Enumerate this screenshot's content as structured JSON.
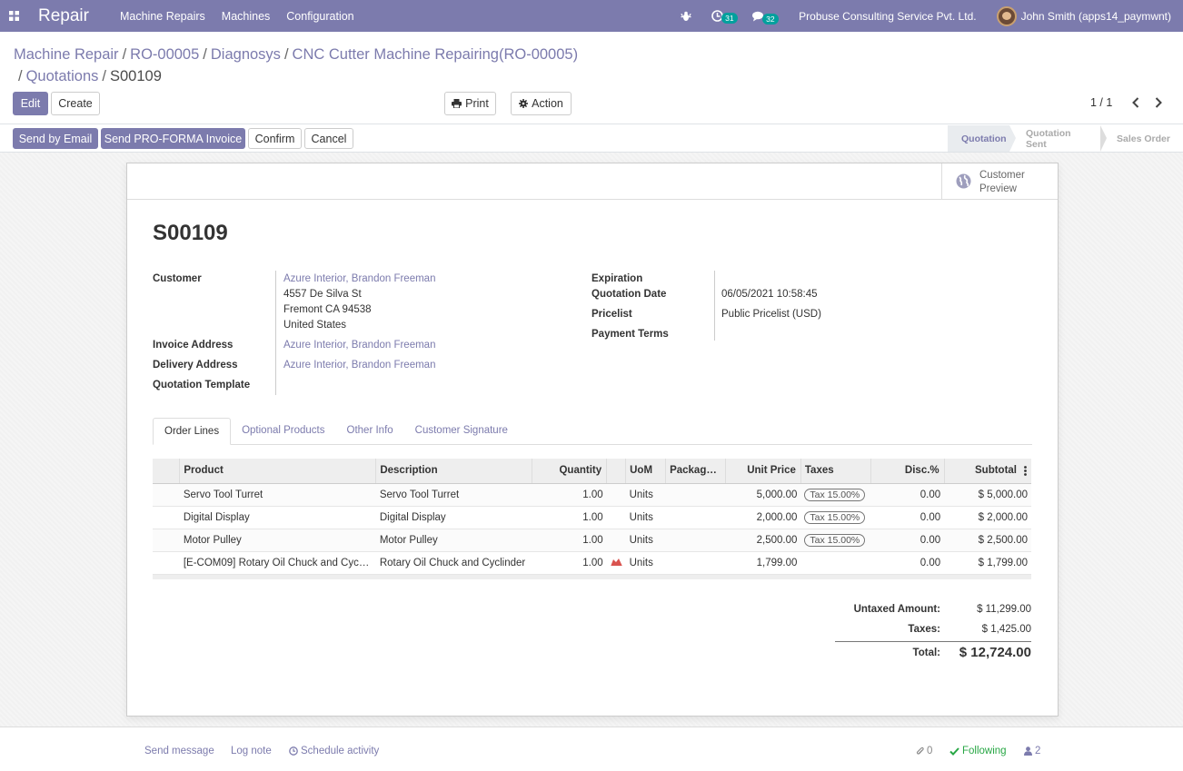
{
  "navbar": {
    "app_name": "Repair",
    "menu": [
      "Machine Repairs",
      "Machines",
      "Configuration"
    ],
    "activity_count": "31",
    "message_count": "32",
    "company": "Probuse Consulting Service Pvt. Ltd.",
    "user": "John Smith (apps14_paymwnt)",
    "brand_color": "#7c7bad"
  },
  "breadcrumb": {
    "items": [
      "Machine Repair",
      "RO-00005",
      "Diagnosys",
      "CNC Cutter Machine Repairing(RO-00005)",
      "Quotations"
    ],
    "current": "S00109",
    "separator": "/"
  },
  "controls": {
    "edit": "Edit",
    "create": "Create",
    "print": "Print",
    "action": "Action",
    "pager": "1 / 1"
  },
  "header_buttons": {
    "send_email": "Send by Email",
    "send_proforma": "Send PRO-FORMA Invoice",
    "confirm": "Confirm",
    "cancel": "Cancel"
  },
  "statusbar": [
    "Quotation",
    "Quotation Sent",
    "Sales Order"
  ],
  "preview": {
    "line1": "Customer",
    "line2": "Preview"
  },
  "form": {
    "title": "S00109",
    "customer_label": "Customer",
    "customer_name": "Azure Interior, Brandon Freeman",
    "customer_street": "4557 De Silva St",
    "customer_city": "Fremont CA 94538",
    "customer_country": "United States",
    "invoice_label": "Invoice Address",
    "invoice_value": "Azure Interior, Brandon Freeman",
    "delivery_label": "Delivery Address",
    "delivery_value": "Azure Interior, Brandon Freeman",
    "template_label": "Quotation Template",
    "expiration_label": "Expiration",
    "quote_date_label": "Quotation Date",
    "quote_date_value": "06/05/2021 10:58:45",
    "pricelist_label": "Pricelist",
    "pricelist_value": "Public Pricelist (USD)",
    "payment_terms_label": "Payment Terms"
  },
  "tabs": [
    "Order Lines",
    "Optional Products",
    "Other Info",
    "Customer Signature"
  ],
  "table": {
    "columns": [
      "Product",
      "Description",
      "Quantity",
      "UoM",
      "Packag…",
      "Unit Price",
      "Taxes",
      "Disc.%",
      "Subtotal"
    ],
    "rows": [
      {
        "product": "Servo Tool Turret",
        "description": "Servo Tool Turret",
        "qty": "1.00",
        "uom": "Units",
        "unit_price": "5,000.00",
        "tax": "Tax 15.00%",
        "disc": "0.00",
        "subtotal": "$ 5,000.00",
        "warn": false
      },
      {
        "product": "Digital Display",
        "description": "Digital Display",
        "qty": "1.00",
        "uom": "Units",
        "unit_price": "2,000.00",
        "tax": "Tax 15.00%",
        "disc": "0.00",
        "subtotal": "$ 2,000.00",
        "warn": false
      },
      {
        "product": "Motor Pulley",
        "description": "Motor Pulley",
        "qty": "1.00",
        "uom": "Units",
        "unit_price": "2,500.00",
        "tax": "Tax 15.00%",
        "disc": "0.00",
        "subtotal": "$ 2,500.00",
        "warn": false
      },
      {
        "product": "[E-COM09] Rotary Oil Chuck and Cyc…",
        "description": "Rotary Oil Chuck and Cyclinder",
        "qty": "1.00",
        "uom": "Units",
        "unit_price": "1,799.00",
        "tax": "",
        "disc": "0.00",
        "subtotal": "$ 1,799.00",
        "warn": true
      }
    ]
  },
  "totals": {
    "untaxed_label": "Untaxed Amount:",
    "untaxed_value": "$ 11,299.00",
    "taxes_label": "Taxes:",
    "taxes_value": "$ 1,425.00",
    "total_label": "Total:",
    "total_value": "$ 12,724.00"
  },
  "chatter": {
    "send_message": "Send message",
    "log_note": "Log note",
    "schedule": "Schedule activity",
    "attachments": "0",
    "following": "Following",
    "followers": "2"
  }
}
